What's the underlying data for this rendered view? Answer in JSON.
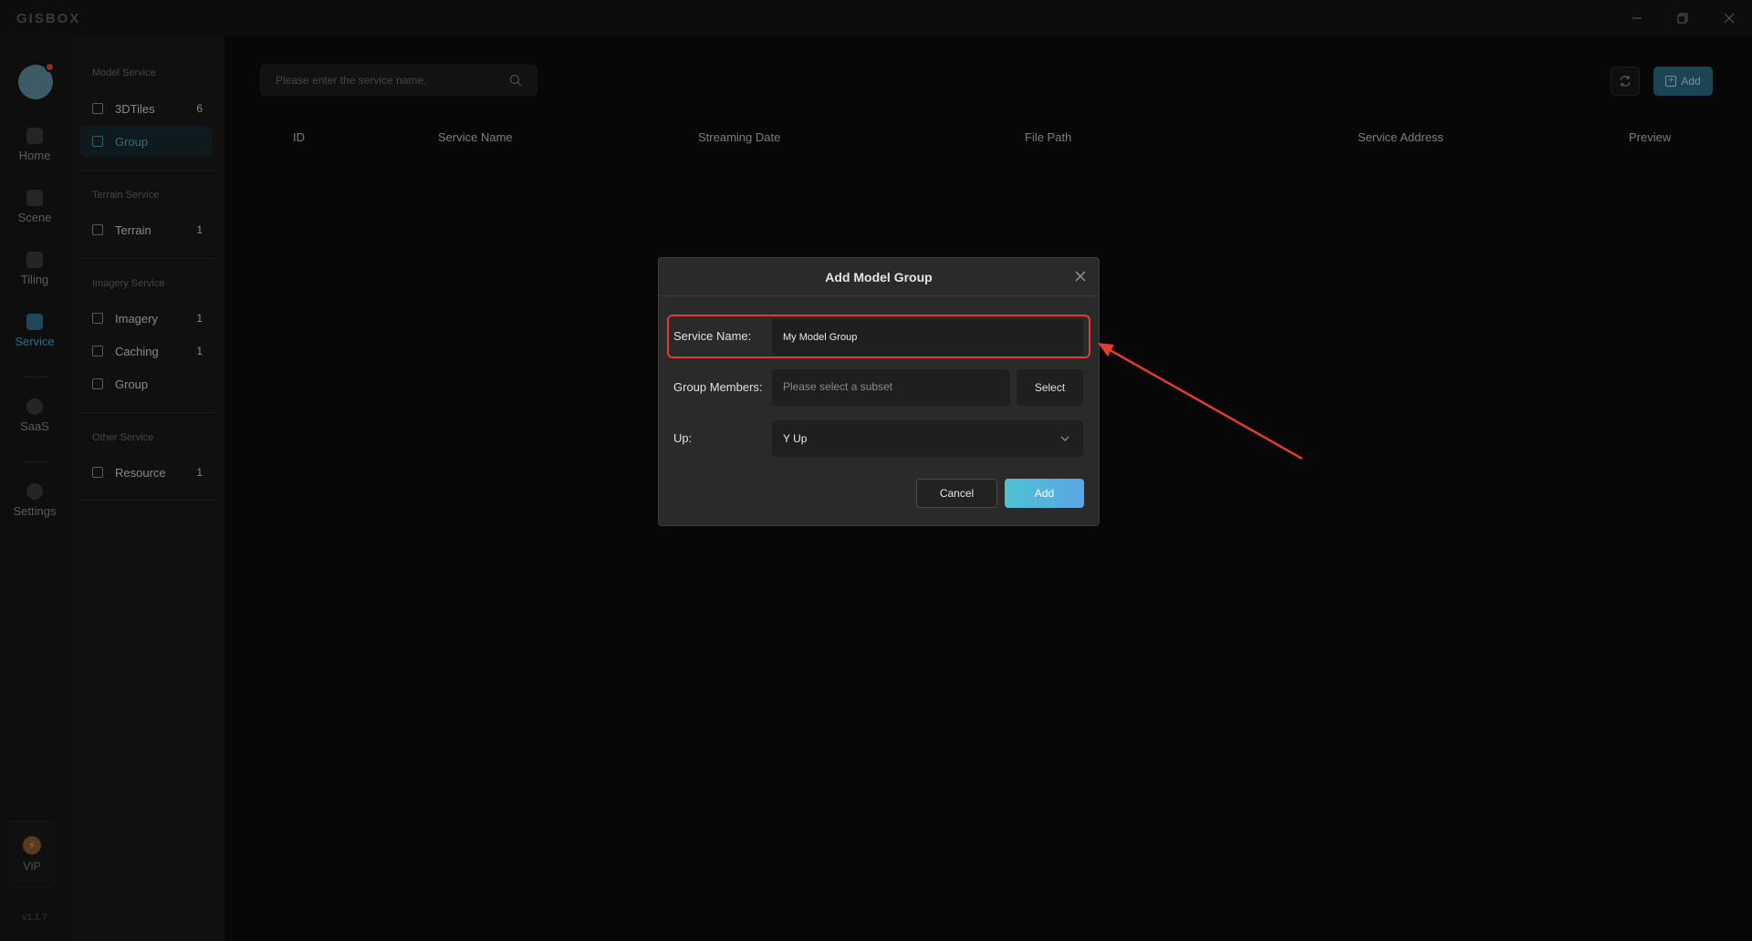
{
  "app": {
    "logo": "GISBOX",
    "version": "v1.1.7"
  },
  "window_controls": [
    "minimize-icon",
    "restore-icon",
    "close-icon"
  ],
  "leftnav": {
    "items": [
      {
        "label": "Home",
        "icon": "home-icon"
      },
      {
        "label": "Scene",
        "icon": "scene-icon"
      },
      {
        "label": "Tiling",
        "icon": "tiling-icon"
      },
      {
        "label": "Service",
        "icon": "service-icon",
        "active": true
      },
      {
        "label": "SaaS",
        "icon": "saas-icon"
      },
      {
        "label": "Settings",
        "icon": "settings-icon"
      }
    ],
    "vip_label": "VIP"
  },
  "subnav": {
    "sections": [
      {
        "title": "Model Service",
        "items": [
          {
            "label": "3DTiles",
            "count": "6"
          },
          {
            "label": "Group",
            "count": "",
            "active": true
          }
        ]
      },
      {
        "title": "Terrain Service",
        "items": [
          {
            "label": "Terrain",
            "count": "1"
          }
        ]
      },
      {
        "title": "Imagery Service",
        "items": [
          {
            "label": "Imagery",
            "count": "1"
          },
          {
            "label": "Caching",
            "count": "1"
          },
          {
            "label": "Group",
            "count": ""
          }
        ]
      },
      {
        "title": "Other Service",
        "items": [
          {
            "label": "Resource",
            "count": "1"
          }
        ]
      }
    ]
  },
  "main": {
    "search_placeholder": "Please enter the service name.",
    "add_label": "Add",
    "columns": [
      "ID",
      "Service Name",
      "Streaming Date",
      "File Path",
      "Service Address",
      "Preview"
    ]
  },
  "modal": {
    "title": "Add Model Group",
    "service_name_label": "Service Name:",
    "service_name_value": "My Model Group",
    "group_members_label": "Group Members:",
    "group_members_placeholder": "Please select a subset",
    "select_label": "Select",
    "up_label": "Up:",
    "up_value": "Y Up",
    "cancel_label": "Cancel",
    "add_label": "Add"
  },
  "colors": {
    "accent": "#4aa6c8",
    "highlight": "#e23c2b",
    "add_gradient_start": "#4fc2d1",
    "add_gradient_end": "#5aa6e6"
  }
}
